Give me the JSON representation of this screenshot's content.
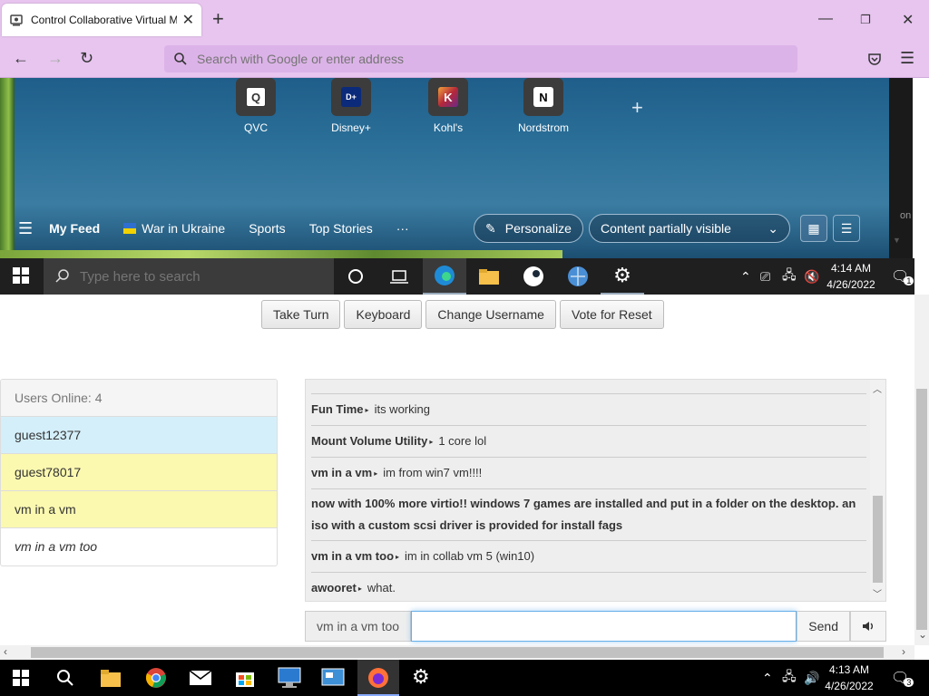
{
  "browser": {
    "tab_title": "Control Collaborative Virtual M",
    "url_placeholder": "Search with Google or enter address"
  },
  "vm_screen": {
    "quick_links": [
      {
        "label": "QVC",
        "glyph": "Q",
        "color": "#ffffff"
      },
      {
        "label": "Disney+",
        "glyph": "D+",
        "color": "#0b2a7a"
      },
      {
        "label": "Kohl's",
        "glyph": "K",
        "color": "#b5283a"
      },
      {
        "label": "Nordstrom",
        "glyph": "N",
        "color": "#ffffff"
      }
    ],
    "feed": {
      "my_feed": "My Feed",
      "war": "War in Ukraine",
      "sports": "Sports",
      "top_stories": "Top Stories",
      "more": "···",
      "personalize": "Personalize",
      "content_visibility": "Content partially visible"
    },
    "side_text": "on",
    "taskbar": {
      "search_placeholder": "Type here to search",
      "time": "4:14 AM",
      "date": "4/26/2022",
      "notif_count": "1"
    }
  },
  "toolbar": {
    "take_turn": "Take Turn",
    "keyboard": "Keyboard",
    "change_username": "Change Username",
    "vote_reset": "Vote for Reset"
  },
  "users": {
    "header": "Users Online: 4",
    "list": [
      "guest12377",
      "guest78017",
      "vm in a vm",
      "vm in a vm too"
    ]
  },
  "chat": {
    "messages": [
      {
        "user": "Fun Time",
        "text": "its working"
      },
      {
        "user": "Mount Volume Utility",
        "text": "1 core lol"
      },
      {
        "user": "vm in a vm",
        "text": "im from win7 vm!!!!"
      },
      {
        "system": "now with 100% more virtio!! windows 7 games are installed and put in a folder on the desktop. an iso with a custom scsi driver is provided for install fags"
      },
      {
        "user": "vm in a vm too",
        "text": "im in collab vm 5 (win10)"
      },
      {
        "user": "awooret",
        "text": "what."
      }
    ],
    "username": "vm in a vm too",
    "input_value": "",
    "send": "Send"
  },
  "taskbar": {
    "time": "4:13 AM",
    "date": "4/26/2022",
    "notif_count": "3"
  }
}
